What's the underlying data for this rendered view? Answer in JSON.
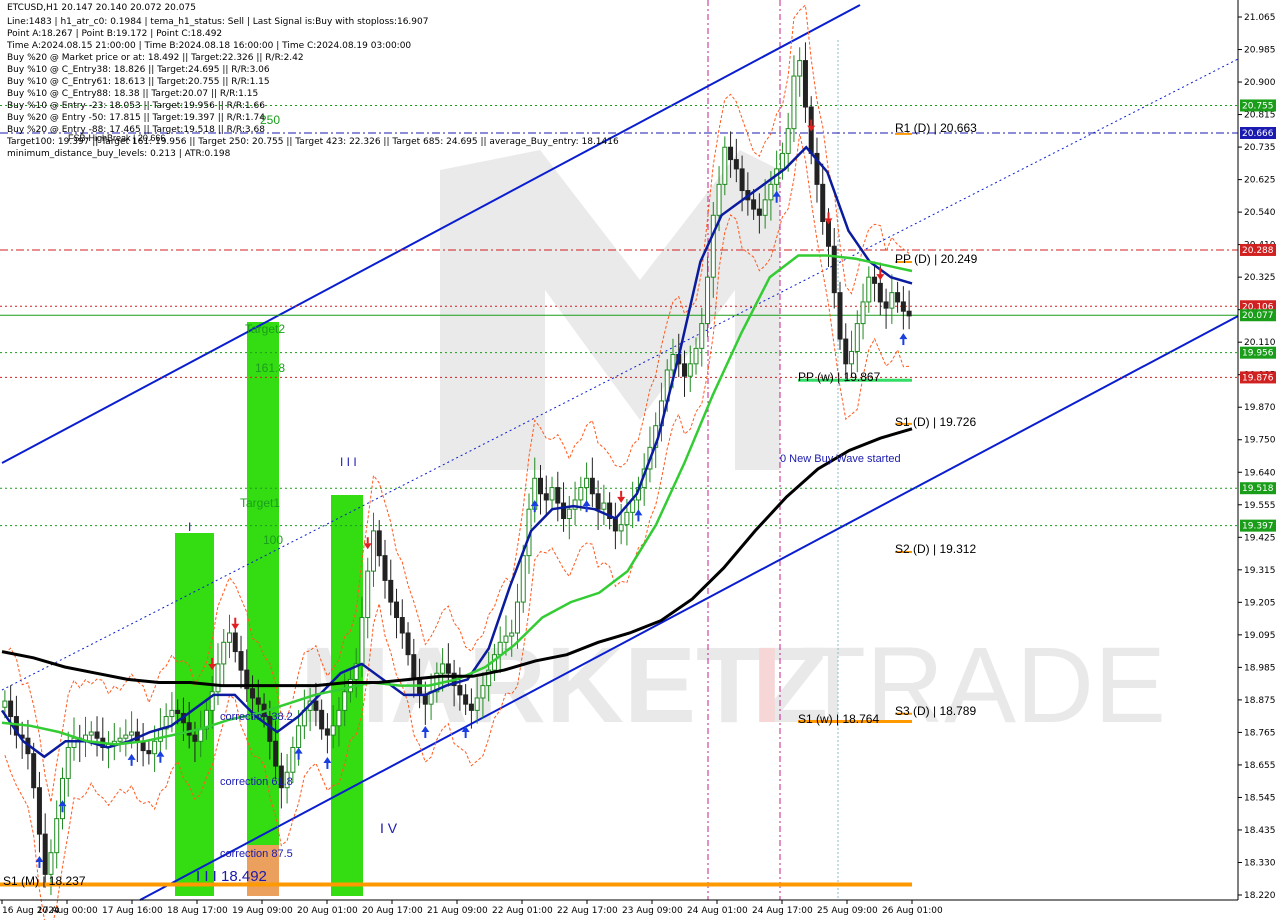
{
  "header": {
    "symbol_line": "ETCUSD,H1  20.147 20.140 20.072 20.075",
    "info_lines": [
      "Line:1483 | h1_atr_c0: 0.1984 | tema_h1_status: Sell | Last Signal is:Buy with stoploss:16.907",
      "Point A:18.267 | Point B:19.172 | Point C:18.492",
      "Time A:2024.08.15 21:00:00 | Time B:2024.08.18 16:00:00 | Time C:2024.08.19 03:00:00",
      "Buy %20 @ Market price or at: 18.492 || Target:22.326 || R/R:2.42",
      "Buy %10 @ C_Entry38: 18.826 || Target:24.695 || R/R:3.06",
      "Buy %10 @ C_Entry61: 18.613 || Target:20.755 || R/R:1.15",
      "Buy %10 @ C_Entry88: 18.38 || Target:20.07 || R/R:1.15",
      "Buy %10 @ Entry -23: 18.053 || Target:19.956 || R/R:1.66",
      "Buy %20 @ Entry -50: 17.815 || Target:19.397 || R/R:1.74",
      "Buy %20 @ Entry -88: 17.465 || Target:19.518 || R/R:3.68",
      "Target100: 19.397 || Target 161: 19.956 || Target 250: 20.755 || Target 423: 22.326 || Target 685: 24.695 || average_Buy_entry: 18.1416",
      "minimum_distance_buy_levels: 0.213 | ATR:0.198"
    ]
  },
  "watermark": {
    "text_left": "MARKETZ",
    "text_accent": "I",
    "text_right": "TRADE"
  },
  "colors": {
    "background": "#ffffff",
    "bull_candle": "#1e8a1e",
    "bear_candle": "#222222",
    "ma_blue": "#0b1b9e",
    "ma_green": "#33cc33",
    "ma_black": "#000000",
    "channel_blue": "#0a1ed0",
    "envelope_orange": "#ff5a1e",
    "level_green": "#1a9e1a",
    "level_red": "#d02020",
    "level_blue": "#1a1ab0",
    "zone_green": "#33dd11",
    "pivot_orange": "#ff9900",
    "arrow_up": "#1a3fe0",
    "arrow_down": "#e02020"
  },
  "chart_data": {
    "type": "candlestick",
    "symbol": "ETCUSD",
    "timeframe": "H1",
    "ohlc_last": {
      "open": 20.147,
      "high": 20.14,
      "low": 20.072,
      "close": 20.075
    },
    "y_range": [
      18.2,
      21.07
    ],
    "x_labels": [
      "16 Aug 2024",
      "17 Aug 00:00",
      "17 Aug 16:00",
      "18 Aug 17:00",
      "19 Aug 09:00",
      "20 Aug 01:00",
      "20 Aug 17:00",
      "21 Aug 09:00",
      "22 Aug 01:00",
      "22 Aug 17:00",
      "23 Aug 09:00",
      "24 Aug 01:00",
      "24 Aug 17:00",
      "25 Aug 09:00",
      "26 Aug 01:00"
    ],
    "y_ticks": [
      "21.065",
      "20.985",
      "20.900",
      "20.815",
      "20.735",
      "20.625",
      "20.540",
      "20.410",
      "20.325",
      "20.190",
      "20.110",
      "19.985",
      "19.870",
      "19.750",
      "19.640",
      "19.555",
      "19.425",
      "19.315",
      "19.205",
      "19.095",
      "18.985",
      "18.875",
      "18.765",
      "18.655",
      "18.545",
      "18.435",
      "18.330",
      "18.220"
    ],
    "price_tags": [
      {
        "value": 20.755,
        "label": "20.755",
        "color": "#1a9e1a"
      },
      {
        "value": 20.666,
        "label": "20.666",
        "color": "#1a1ab0"
      },
      {
        "value": 20.288,
        "label": "20.288",
        "color": "#d02020"
      },
      {
        "value": 20.106,
        "label": "20.106",
        "color": "#d02020"
      },
      {
        "value": 20.077,
        "label": "20.077",
        "color": "#1a9e1a"
      },
      {
        "value": 19.956,
        "label": "19.956",
        "color": "#1a9e1a"
      },
      {
        "value": 19.876,
        "label": "19.876",
        "color": "#d02020"
      },
      {
        "value": 19.518,
        "label": "19.518",
        "color": "#1a9e1a"
      },
      {
        "value": 19.397,
        "label": "19.397",
        "color": "#1a9e1a"
      }
    ],
    "horizontal_levels": [
      {
        "value": 20.755,
        "style": "dotted",
        "color": "#1a9e1a"
      },
      {
        "value": 20.666,
        "style": "dashdot",
        "color": "#1a1ab0"
      },
      {
        "value": 20.288,
        "style": "dashdot",
        "color": "#d02020"
      },
      {
        "value": 20.106,
        "style": "dotted",
        "color": "#d02020"
      },
      {
        "value": 20.077,
        "style": "solid",
        "color": "#1a9e1a"
      },
      {
        "value": 19.956,
        "style": "dotted",
        "color": "#1a9e1a"
      },
      {
        "value": 19.876,
        "style": "dotted",
        "color": "#d02020"
      },
      {
        "value": 19.518,
        "style": "dotted",
        "color": "#1a9e1a"
      },
      {
        "value": 19.397,
        "style": "dotted",
        "color": "#1a9e1a"
      }
    ],
    "pivots": [
      {
        "label": "R1 (D) | 20.663",
        "value": 20.663,
        "tf": "D"
      },
      {
        "label": "PP (D) | 20.249",
        "value": 20.249,
        "tf": "D"
      },
      {
        "label": "S1 (D) | 19.726",
        "value": 19.726,
        "tf": "D"
      },
      {
        "label": "S2 (D) | 19.312",
        "value": 19.312,
        "tf": "D"
      },
      {
        "label": "S3 (D) | 18.789",
        "value": 18.789,
        "tf": "D"
      },
      {
        "label": "PP (w) | 19.867",
        "value": 19.867,
        "tf": "w"
      },
      {
        "label": "S1 (w) | 18.764",
        "value": 18.764,
        "tf": "w"
      },
      {
        "label": "S1 (M) | 18.237",
        "value": 18.237,
        "tf": "M"
      }
    ],
    "annotations": [
      "Target2",
      "161.8",
      "Target1",
      "100",
      "250",
      "FSB-HighBreak | 20.666",
      "I",
      "I I I",
      "I V",
      "I I I 18.492",
      "correction 38.2",
      "correction 61.8",
      "correction 87.5",
      "0 New Buy Wave started"
    ],
    "series": [
      {
        "name": "price",
        "values": [
          18.83,
          18.78,
          18.72,
          18.71,
          18.66,
          18.55,
          18.4,
          18.27,
          18.34,
          18.45,
          18.58,
          18.68,
          18.71,
          18.7,
          18.72,
          18.73,
          18.71,
          18.68,
          18.69,
          18.7,
          18.71,
          18.72,
          18.73,
          18.7,
          18.67,
          18.66,
          18.7,
          18.74,
          18.78,
          18.8,
          18.79,
          18.76,
          18.72,
          18.7,
          18.74,
          18.8,
          18.86,
          18.95,
          19.02,
          19.05,
          18.99,
          18.93,
          18.87,
          18.84,
          18.82,
          18.78,
          18.7,
          18.62,
          18.55,
          18.6,
          18.68,
          18.75,
          18.8,
          18.83,
          18.8,
          18.74,
          18.72,
          18.75,
          18.8,
          18.86,
          18.9,
          18.95,
          19.1,
          19.25,
          19.38,
          19.3,
          19.22,
          19.15,
          19.1,
          19.05,
          18.98,
          18.9,
          18.85,
          18.82,
          18.86,
          18.92,
          18.95,
          18.92,
          18.88,
          18.85,
          18.82,
          18.8,
          18.84,
          18.88,
          18.93,
          18.98,
          19.02,
          19.04,
          19.05,
          19.15,
          19.3,
          19.45,
          19.55,
          19.5,
          19.48,
          19.52,
          19.47,
          19.42,
          19.45,
          19.48,
          19.52,
          19.55,
          19.5,
          19.45,
          19.47,
          19.42,
          19.38,
          19.4,
          19.44,
          19.48,
          19.52,
          19.58,
          19.65,
          19.72,
          19.8,
          19.9,
          19.95,
          19.92,
          19.88,
          19.92,
          19.97,
          20.05,
          20.2,
          20.4,
          20.5,
          20.62,
          20.58,
          20.55,
          20.48,
          20.45,
          20.42,
          20.4,
          20.45,
          20.5,
          20.55,
          20.6,
          20.68,
          20.85,
          20.9,
          20.75,
          20.6,
          20.5,
          20.38,
          20.3,
          20.15,
          20.0,
          19.92,
          19.96,
          20.05,
          20.12,
          20.2,
          20.18,
          20.12,
          20.1,
          20.15,
          20.12,
          20.09,
          20.075
        ]
      },
      {
        "name": "ma_fast",
        "values": [
          18.8,
          18.7,
          18.65,
          18.7,
          18.7,
          18.68,
          18.7,
          18.73,
          18.75,
          18.8,
          18.85,
          18.85,
          18.78,
          18.73,
          18.78,
          18.85,
          18.92,
          18.95,
          18.9,
          18.85,
          18.85,
          18.88,
          18.9,
          19.0,
          19.2,
          19.38,
          19.45,
          19.46,
          19.45,
          19.42,
          19.5,
          19.68,
          19.95,
          20.25,
          20.4,
          20.45,
          20.5,
          20.55,
          20.62,
          20.54,
          20.35,
          20.25,
          20.2,
          20.18
        ]
      },
      {
        "name": "ma_mid",
        "values": [
          18.76,
          18.75,
          18.73,
          18.7,
          18.69,
          18.7,
          18.72,
          18.74,
          18.77,
          18.79,
          18.82,
          18.85,
          18.87,
          18.89,
          18.88,
          18.88,
          18.9,
          18.94,
          19.01,
          19.1,
          19.15,
          19.18,
          19.25,
          19.4,
          19.6,
          19.82,
          20.02,
          20.2,
          20.27,
          20.27,
          20.26,
          20.24,
          20.22
        ]
      },
      {
        "name": "ma_slow",
        "values": [
          18.99,
          18.97,
          18.94,
          18.92,
          18.9,
          18.89,
          18.89,
          18.88,
          18.88,
          18.88,
          18.88,
          18.89,
          18.89,
          18.9,
          18.91,
          18.91,
          18.93,
          18.96,
          18.98,
          19.02,
          19.05,
          19.09,
          19.16,
          19.26,
          19.38,
          19.49,
          19.58,
          19.64,
          19.68,
          19.71
        ]
      }
    ]
  }
}
